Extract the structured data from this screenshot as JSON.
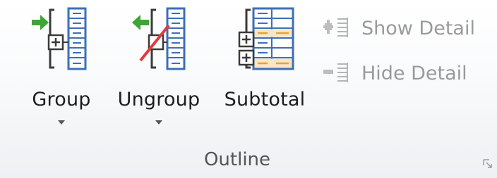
{
  "group": {
    "title": "Outline"
  },
  "buttons": {
    "group": {
      "label": "Group",
      "icon": "group-rows-icon",
      "has_dropdown": true
    },
    "ungroup": {
      "label": "Ungroup",
      "icon": "ungroup-rows-icon",
      "has_dropdown": true
    },
    "subtotal": {
      "label": "Subtotal",
      "icon": "subtotal-icon",
      "has_dropdown": false
    },
    "show_detail": {
      "label": "Show Detail",
      "icon": "show-detail-icon",
      "enabled": false
    },
    "hide_detail": {
      "label": "Hide Detail",
      "icon": "hide-detail-icon",
      "enabled": false
    }
  },
  "colors": {
    "arrow_green": "#3fa535",
    "strike_red": "#e03a3a",
    "grid_blue": "#3e6fb5",
    "subtotal_orange": "#e8a23a",
    "disabled_text": "#9a9a9a"
  }
}
